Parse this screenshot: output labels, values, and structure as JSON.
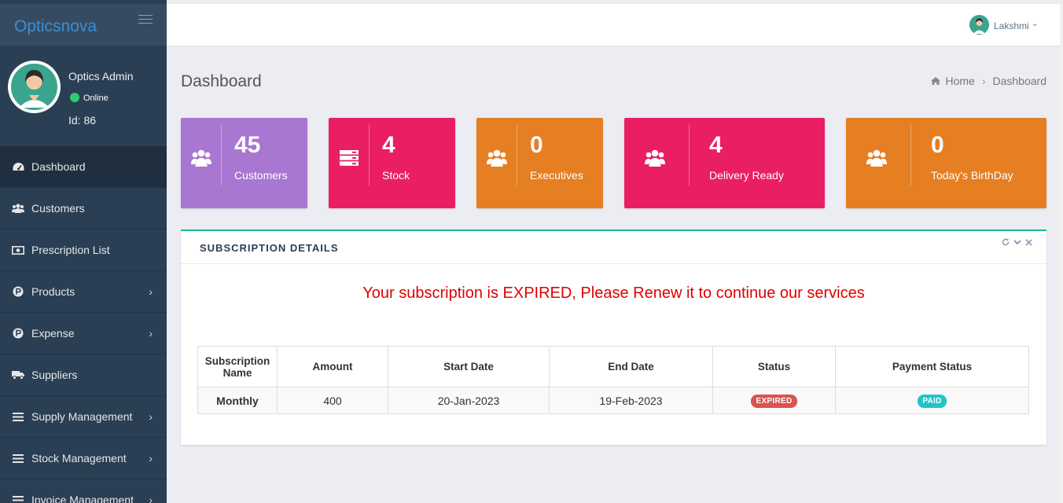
{
  "brand": "Opticsnova",
  "profile": {
    "name": "Optics Admin",
    "status": "Online",
    "id": "Id: 86"
  },
  "menu": [
    {
      "label": "Dashboard",
      "icon": "dashboard-icon",
      "submenu": false
    },
    {
      "label": "Customers",
      "icon": "users-icon",
      "submenu": false
    },
    {
      "label": "Prescription List",
      "icon": "money-icon",
      "submenu": false
    },
    {
      "label": "Products",
      "icon": "p-circle-icon",
      "submenu": true
    },
    {
      "label": "Expense",
      "icon": "p-circle-icon",
      "submenu": true
    },
    {
      "label": "Suppliers",
      "icon": "truck-icon",
      "submenu": false
    },
    {
      "label": "Supply Management",
      "icon": "list-icon",
      "submenu": true
    },
    {
      "label": "Stock Management",
      "icon": "list-icon",
      "submenu": true
    },
    {
      "label": "Invoice Management",
      "icon": "list-icon",
      "submenu": true
    }
  ],
  "topbar": {
    "user": "Lakshmi"
  },
  "page": {
    "title": "Dashboard"
  },
  "breadcrumb": {
    "home": "Home",
    "current": "Dashboard"
  },
  "cards": [
    {
      "value": "45",
      "label": "Customers",
      "color": "#a877d1",
      "icon": "users-icon"
    },
    {
      "value": "4",
      "label": "Stock",
      "color": "#e91e63",
      "icon": "server-icon"
    },
    {
      "value": "0",
      "label": "Executives",
      "color": "#e67e22",
      "icon": "users-icon"
    },
    {
      "value": "4",
      "label": "Delivery Ready",
      "color": "#e91e63",
      "icon": "users-icon"
    },
    {
      "value": "0",
      "label": "Today's BirthDay",
      "color": "#e67e22",
      "icon": "users-icon"
    }
  ],
  "subscription": {
    "title": "SUBSCRIPTION DETAILS",
    "message": "Your subscription is EXPIRED, Please Renew it to continue our services",
    "headers": [
      "Subscription Name",
      "Amount",
      "Start Date",
      "End Date",
      "Status",
      "Payment Status"
    ],
    "row": {
      "name": "Monthly",
      "amount": "400",
      "start": "20-Jan-2023",
      "end": "19-Feb-2023",
      "status": "EXPIRED",
      "payment": "PAID"
    }
  }
}
